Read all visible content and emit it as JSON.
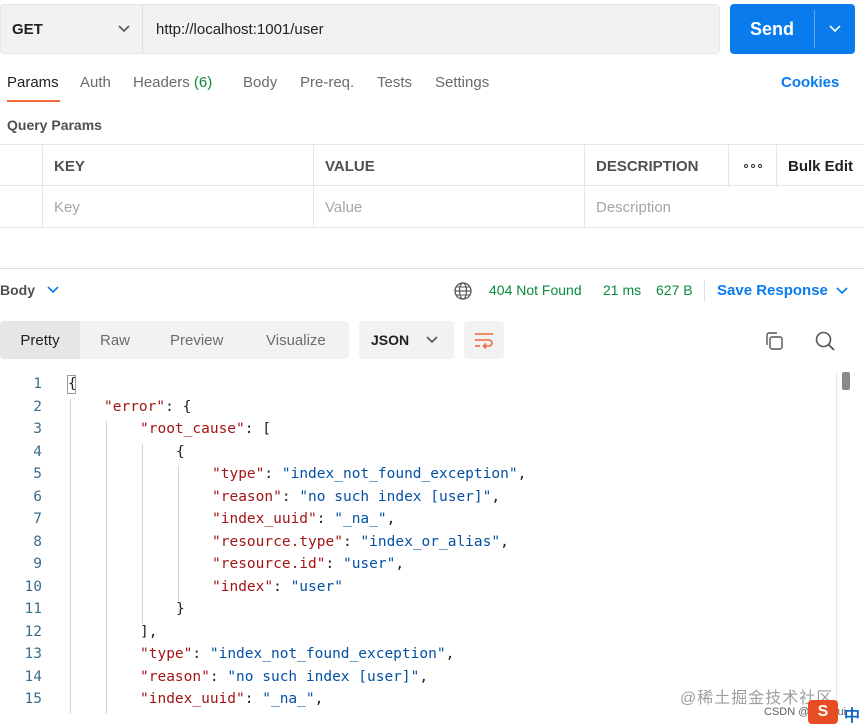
{
  "request": {
    "method": "GET",
    "url": "http://localhost:1001/user",
    "send_label": "Send"
  },
  "tabs": {
    "params": "Params",
    "auth": "Auth",
    "headers": "Headers",
    "headers_count": "(6)",
    "body": "Body",
    "prereq": "Pre-req.",
    "tests": "Tests",
    "settings": "Settings",
    "cookies": "Cookies"
  },
  "query_params": {
    "title": "Query Params",
    "columns": {
      "key": "KEY",
      "value": "VALUE",
      "description": "DESCRIPTION",
      "bulk_edit": "Bulk Edit"
    },
    "placeholders": {
      "key": "Key",
      "value": "Value",
      "description": "Description"
    }
  },
  "response": {
    "body_label": "Body",
    "status": "404 Not Found",
    "time": "21 ms",
    "size": "627 B",
    "save_label": "Save Response"
  },
  "view": {
    "tabs": [
      "Pretty",
      "Raw",
      "Preview",
      "Visualize"
    ],
    "format": "JSON"
  },
  "code_lines": [
    {
      "n": "1",
      "indent": 0,
      "parts": [
        [
          "p",
          "{"
        ]
      ]
    },
    {
      "n": "2",
      "indent": 1,
      "parts": [
        [
          "k",
          "\"error\""
        ],
        [
          "p",
          ": {"
        ]
      ]
    },
    {
      "n": "3",
      "indent": 2,
      "parts": [
        [
          "k",
          "\"root_cause\""
        ],
        [
          "p",
          ": ["
        ]
      ]
    },
    {
      "n": "4",
      "indent": 3,
      "parts": [
        [
          "p",
          "{"
        ]
      ]
    },
    {
      "n": "5",
      "indent": 4,
      "parts": [
        [
          "k",
          "\"type\""
        ],
        [
          "p",
          ": "
        ],
        [
          "s",
          "\"index_not_found_exception\""
        ],
        [
          "p",
          ","
        ]
      ]
    },
    {
      "n": "6",
      "indent": 4,
      "parts": [
        [
          "k",
          "\"reason\""
        ],
        [
          "p",
          ": "
        ],
        [
          "s",
          "\"no such index [user]\""
        ],
        [
          "p",
          ","
        ]
      ]
    },
    {
      "n": "7",
      "indent": 4,
      "parts": [
        [
          "k",
          "\"index_uuid\""
        ],
        [
          "p",
          ": "
        ],
        [
          "s",
          "\"_na_\""
        ],
        [
          "p",
          ","
        ]
      ]
    },
    {
      "n": "8",
      "indent": 4,
      "parts": [
        [
          "k",
          "\"resource.type\""
        ],
        [
          "p",
          ": "
        ],
        [
          "s",
          "\"index_or_alias\""
        ],
        [
          "p",
          ","
        ]
      ]
    },
    {
      "n": "9",
      "indent": 4,
      "parts": [
        [
          "k",
          "\"resource.id\""
        ],
        [
          "p",
          ": "
        ],
        [
          "s",
          "\"user\""
        ],
        [
          "p",
          ","
        ]
      ]
    },
    {
      "n": "10",
      "indent": 4,
      "parts": [
        [
          "k",
          "\"index\""
        ],
        [
          "p",
          ": "
        ],
        [
          "s",
          "\"user\""
        ]
      ]
    },
    {
      "n": "11",
      "indent": 3,
      "parts": [
        [
          "p",
          "}"
        ]
      ]
    },
    {
      "n": "12",
      "indent": 2,
      "parts": [
        [
          "p",
          "],"
        ]
      ]
    },
    {
      "n": "13",
      "indent": 2,
      "parts": [
        [
          "k",
          "\"type\""
        ],
        [
          "p",
          ": "
        ],
        [
          "s",
          "\"index_not_found_exception\""
        ],
        [
          "p",
          ","
        ]
      ]
    },
    {
      "n": "14",
      "indent": 2,
      "parts": [
        [
          "k",
          "\"reason\""
        ],
        [
          "p",
          ": "
        ],
        [
          "s",
          "\"no such index [user]\""
        ],
        [
          "p",
          ","
        ]
      ]
    },
    {
      "n": "15",
      "indent": 2,
      "parts": [
        [
          "k",
          "\"index_uuid\""
        ],
        [
          "p",
          ": "
        ],
        [
          "s",
          "\"_na_\""
        ],
        [
          "p",
          ","
        ]
      ]
    }
  ],
  "watermark": {
    "site": "@稀土掘金技术社区",
    "csdn": "CSDN @AI_xhui",
    "logo": "S",
    "lang": "中"
  }
}
